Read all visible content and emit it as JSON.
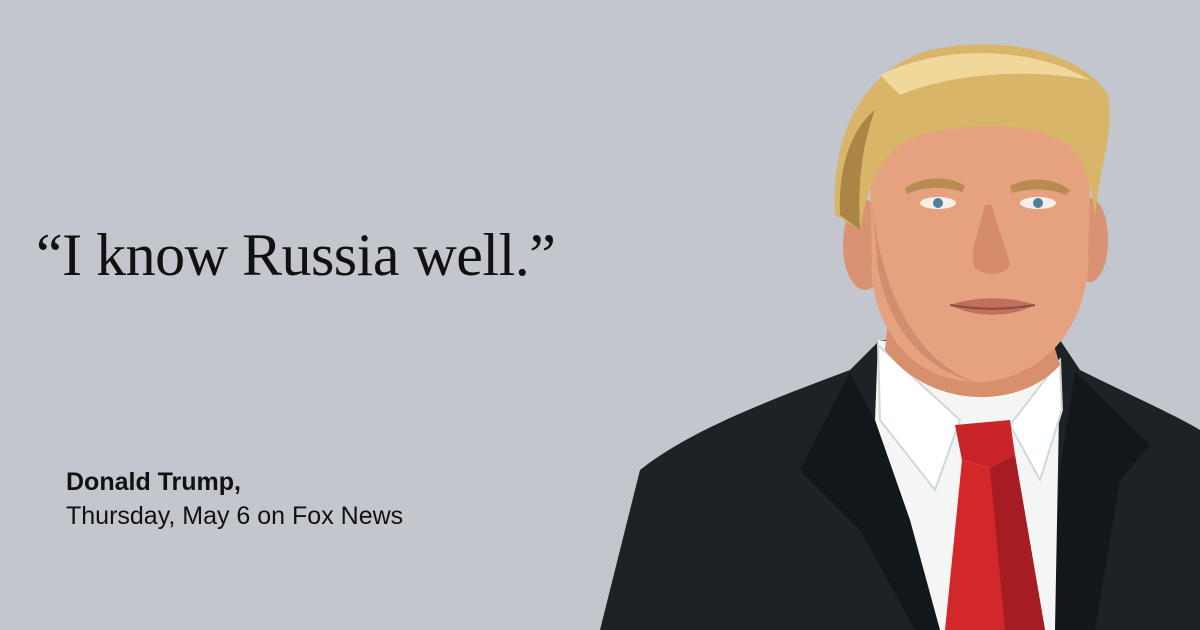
{
  "quote": {
    "text": "“I know Russia well.”"
  },
  "attribution": {
    "speaker": "Donald Trump,",
    "source": "Thursday, May 6 on Fox News"
  },
  "colors": {
    "background": "#c3c6cd",
    "text": "#111111",
    "suit": "#1c2226",
    "shirt": "#f4f6f6",
    "tie": "#d2282a",
    "hair": "#d9b56a",
    "skin": "#e6a27f"
  },
  "portrait": {
    "icon": "portrait-illustration-icon"
  }
}
